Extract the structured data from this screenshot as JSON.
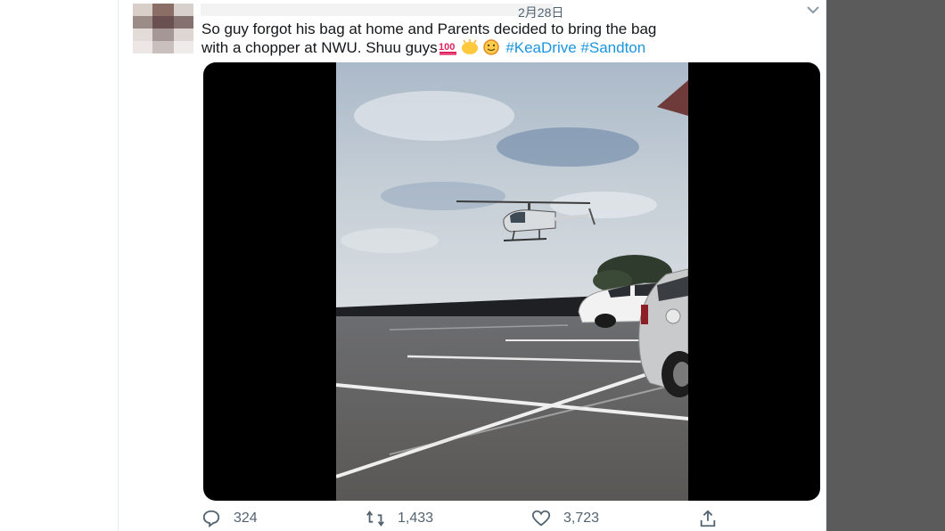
{
  "tweet": {
    "date": "2月28日",
    "text_line1": "So guy forgot his bag at home and Parents decided to bring the bag",
    "text_line2": "with a chopper at NWU. Shuu guys",
    "hashtags": [
      "#KeaDrive",
      "#Sandton"
    ],
    "emoji_names": [
      "hundred-points-icon",
      "clapping-hands-icon",
      "smiling-face-icon"
    ],
    "stats": {
      "replies": "324",
      "retweets": "1,433",
      "likes": "3,723"
    }
  },
  "colors": {
    "text": "#14171a",
    "hashtag": "#1b95e0",
    "muted": "#536471",
    "frame_left": "#ffffff",
    "frame_right": "#5b5b5b"
  }
}
